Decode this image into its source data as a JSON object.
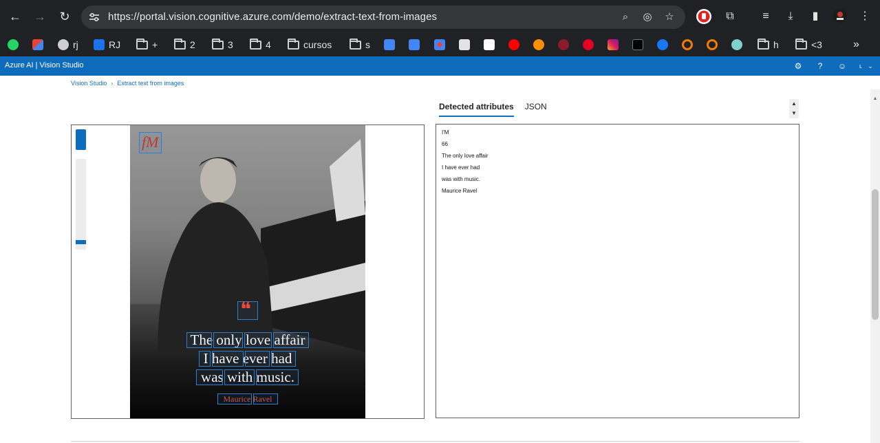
{
  "browser": {
    "url": "https://portal.vision.cognitive.azure.com/demo/extract-text-from-images",
    "bookmarks": [
      {
        "label": "rj",
        "icon": "globe-icon"
      },
      {
        "label": "RJ",
        "icon": "site-icon"
      },
      {
        "label": "+",
        "icon": "folder-icon"
      },
      {
        "label": "2",
        "icon": "folder-icon"
      },
      {
        "label": "3",
        "icon": "folder-icon"
      },
      {
        "label": "4",
        "icon": "folder-icon"
      },
      {
        "label": "cursos",
        "icon": "folder-icon"
      },
      {
        "label": "s",
        "icon": "folder-icon"
      },
      {
        "label": "h",
        "icon": "folder-icon"
      },
      {
        "label": "<3",
        "icon": "folder-icon"
      }
    ]
  },
  "azure": {
    "title": "Azure AI  |  Vision Studio"
  },
  "breadcrumb": {
    "items": [
      "Vision Studio",
      "Extract text from images"
    ],
    "separator": "›"
  },
  "tabs": {
    "detected": "Detected attributes",
    "json": "JSON"
  },
  "results": {
    "lines": [
      "I'M",
      "66",
      "The only love affair",
      "I have ever had",
      "was with music.",
      "Maurice Ravel"
    ]
  },
  "image": {
    "logo_text": "fM",
    "quote_mark": "❝",
    "quote_lines": [
      "The only love affair",
      "I have ever had",
      "was with music."
    ],
    "author": "Maurice Ravel"
  },
  "colors": {
    "azure_blue": "#0f6cbd",
    "chrome_dark": "#202124",
    "bbox_blue": "#2f7fd1"
  }
}
